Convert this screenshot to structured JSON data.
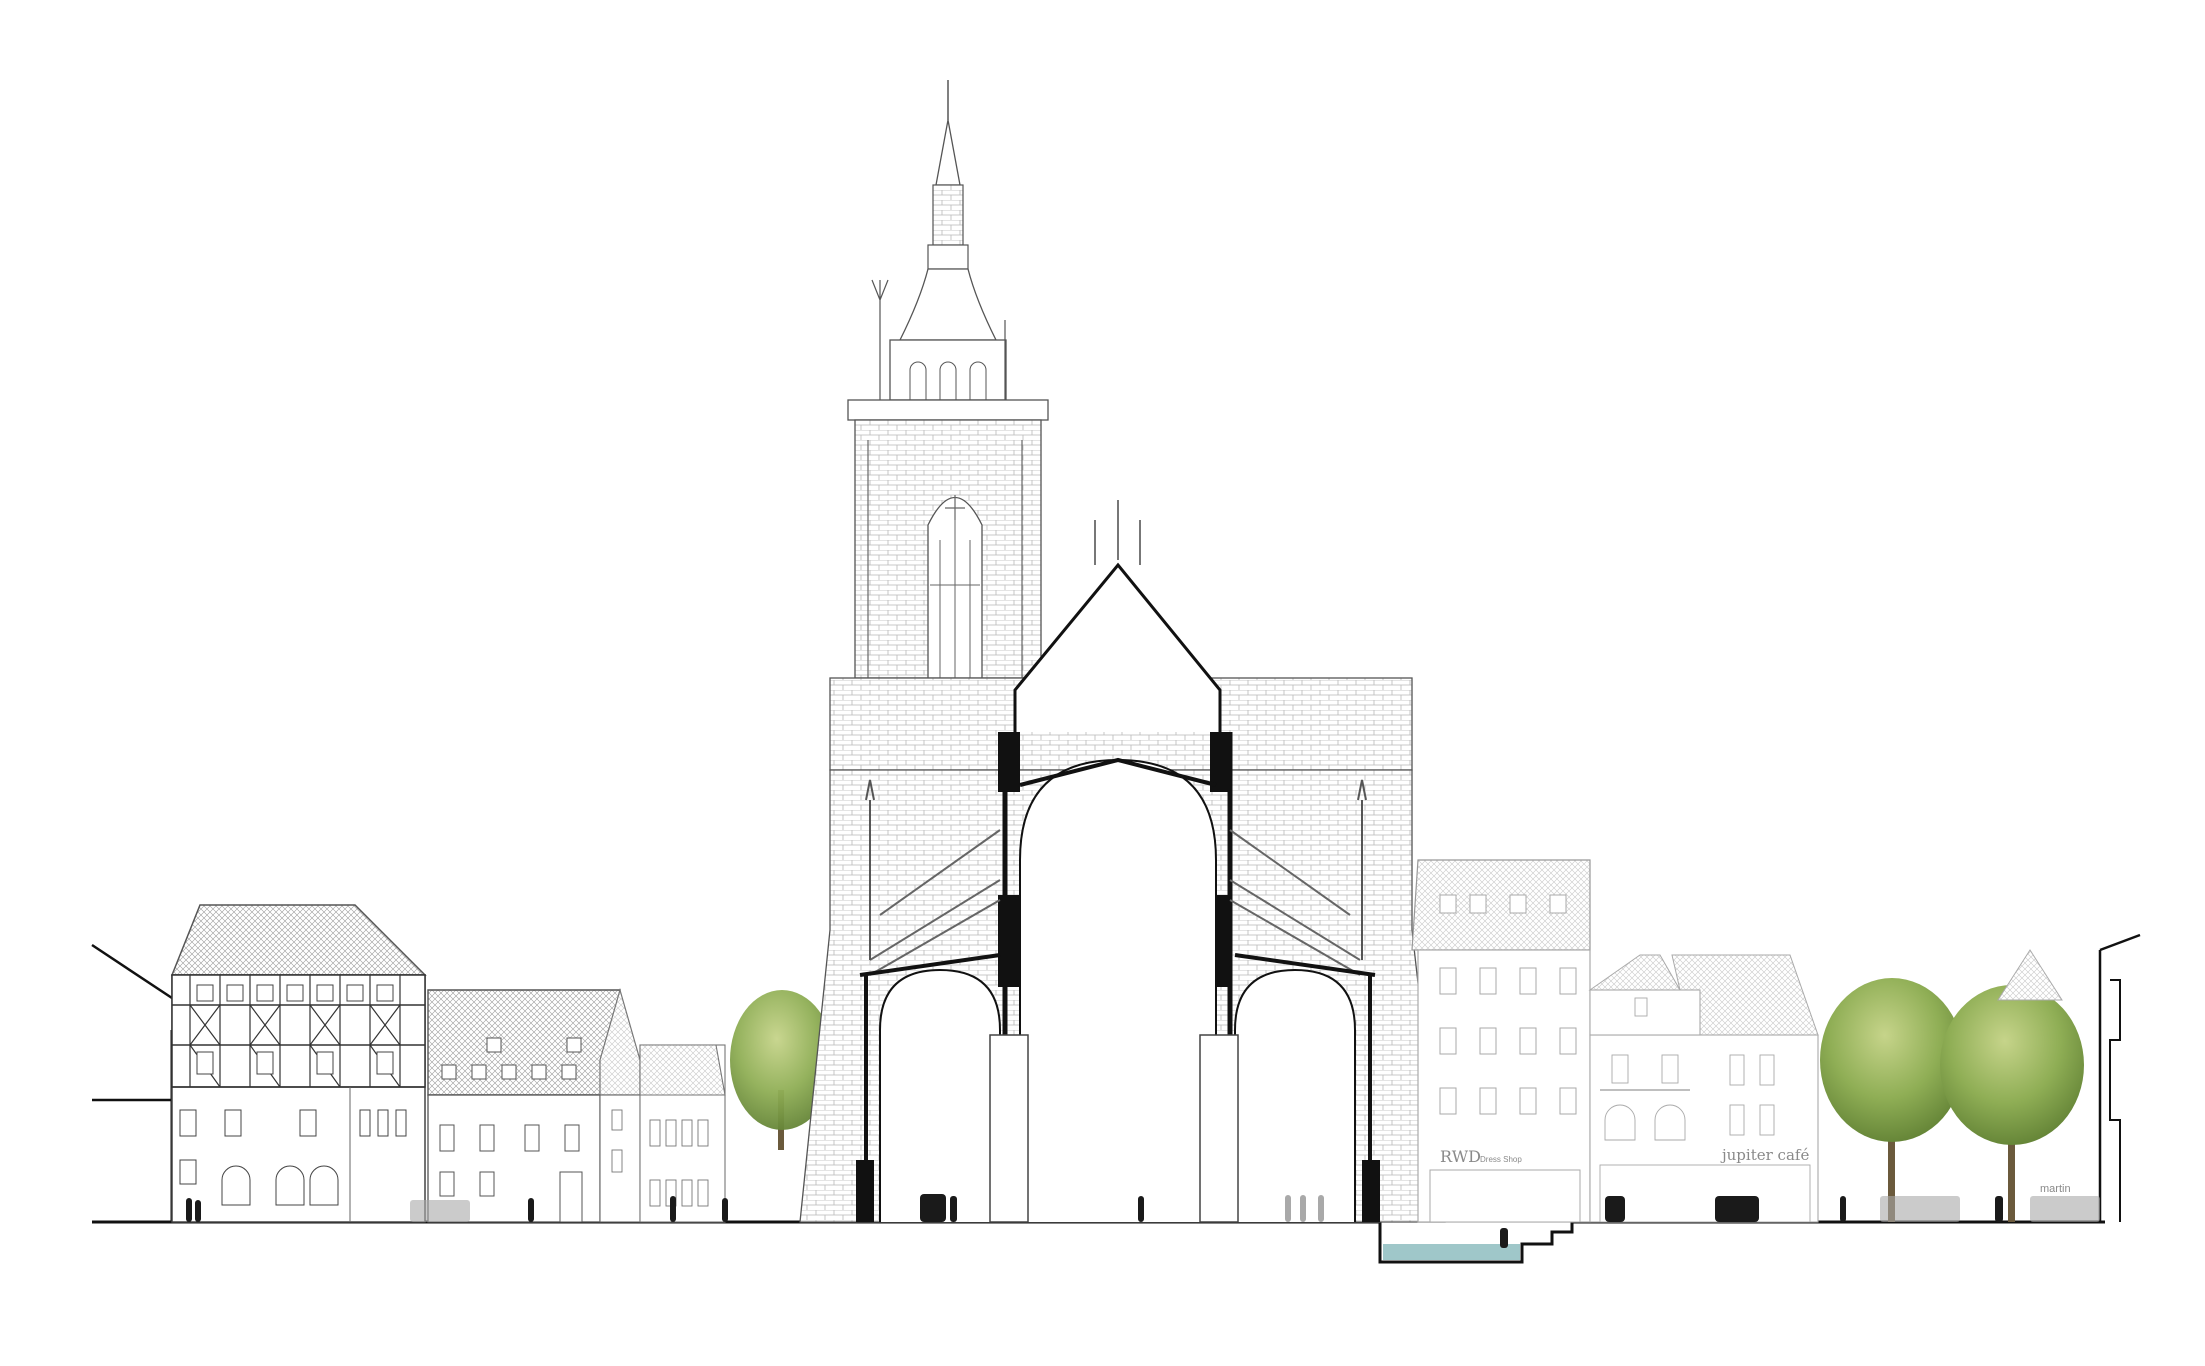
{
  "drawing": {
    "type": "architectural street section",
    "signs": {
      "rwd": "RWD",
      "rwd_sub": "Dress Shop",
      "cafe": "jupiter café",
      "martin": "martin"
    }
  },
  "colors": {
    "background": "#ffffff",
    "section_cut": "#111111",
    "elevation_line": "#6f6f6f",
    "light_line": "#b5b5b5",
    "tree_green": "#8fae55",
    "tree_shadow": "#6d8d3c",
    "water": "#9fc7c9",
    "people": "#1a1a1a",
    "ghost_people": "#a9a9a9"
  }
}
